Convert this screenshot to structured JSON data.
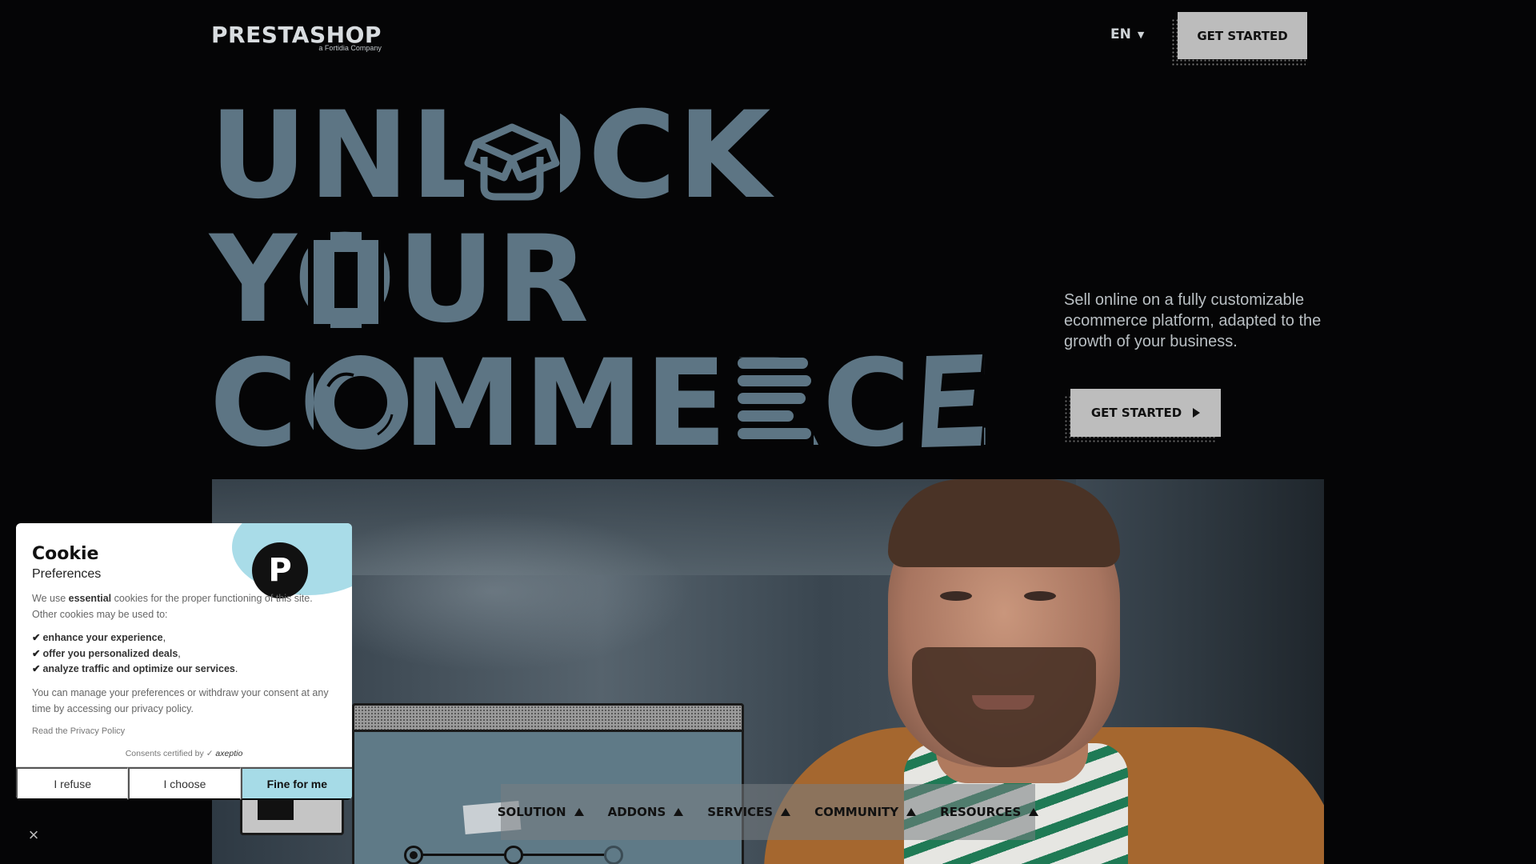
{
  "header": {
    "logo_text": "PRESTASHOP",
    "logo_sub": "a Fortidia Company",
    "language": "EN",
    "cta_label": "GET STARTED"
  },
  "hero": {
    "headline": [
      "UNLOCK",
      "YOUR",
      "COMMERCE"
    ],
    "tagline": "Sell online on a fully customizable ecommerce platform, adapted to the growth of your business.",
    "cta_label": "GET STARTED",
    "headline_color": "#5d7584"
  },
  "bottom_nav": {
    "items": [
      {
        "label": "SOLUTION"
      },
      {
        "label": "ADDONS"
      },
      {
        "label": "SERVICES"
      },
      {
        "label": "COMMUNITY"
      },
      {
        "label": "RESOURCES"
      }
    ]
  },
  "cookie": {
    "title": "Cookie",
    "subtitle": "Preferences",
    "intro_before": "We use ",
    "intro_bold": "essential",
    "intro_after": " cookies for the proper functioning of this site. Other cookies may be used to:",
    "list": [
      {
        "text": "enhance your experience",
        "suffix": ","
      },
      {
        "text": "offer you personalized deals",
        "suffix": ","
      },
      {
        "text": "analyze traffic and optimize our services",
        "suffix": "."
      }
    ],
    "manage_text": "You can manage your preferences or withdraw your consent at any time by accessing our privacy policy.",
    "privacy_link": "Read the Privacy Policy",
    "certified_text": "Consents certified by",
    "certified_brand": "axeptio",
    "buttons": {
      "refuse": "I refuse",
      "choose": "I choose",
      "accept": "Fine for me"
    },
    "logo_glyph": "P",
    "accent_color": "#a6dbe7"
  },
  "close_icon": "×"
}
